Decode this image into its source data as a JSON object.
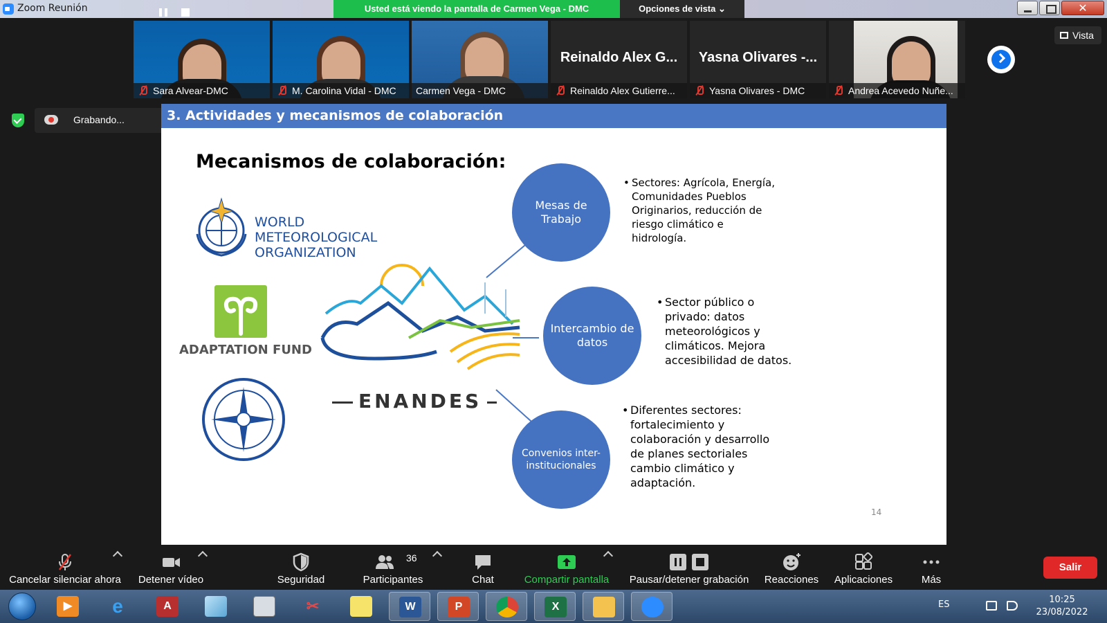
{
  "window": {
    "title": "Zoom Reunión",
    "viewing_banner": "Usted está viendo la pantalla de Carmen Vega - DMC",
    "view_options": "Opciones de vista ⌄",
    "close_glyph": "✕"
  },
  "participants": [
    {
      "name": "Sara Alvear-DMC",
      "muted": true
    },
    {
      "name": "M. Carolina Vidal - DMC",
      "muted": true
    },
    {
      "name": "Carmen Vega - DMC",
      "muted": false,
      "active": true
    },
    {
      "name": "Reinaldo Alex Gutierre...",
      "display": "Reinaldo Alex G...",
      "muted": true
    },
    {
      "name": "Yasna Olivares - DMC",
      "display": "Yasna Olivares -...",
      "muted": true
    },
    {
      "name": "Andrea Acevedo Nuñe...",
      "muted": true
    }
  ],
  "view_button": "Vista",
  "recording": {
    "label": "Grabando..."
  },
  "slide": {
    "header": "3. Actividades y mecanismos de colaboración",
    "title": "Mecanismos de colaboración:",
    "logos": {
      "wmo_lines": [
        "WORLD",
        "METEOROLOGICAL",
        "ORGANIZATION"
      ],
      "adaptation_fund": "ADAPTATION FUND",
      "enandes": "ENANDES"
    },
    "circles": [
      {
        "label": "Mesas de Trabajo"
      },
      {
        "label": "Intercambio de datos"
      },
      {
        "label": "Convenios inter-institucionales"
      }
    ],
    "bullets": [
      "Sectores: Agrícola, Energía, Comunidades Pueblos Originarios, reducción de riesgo climático e hidrología.",
      "Sector público o privado: datos meteorológicos y climáticos. Mejora accesibilidad de datos.",
      "Diferentes sectores: fortalecimiento y colaboración y desarrollo de planes sectoriales cambio climático y adaptación."
    ],
    "page_number": "14"
  },
  "toolbar": {
    "unmute": "Cancelar silenciar ahora",
    "video": "Detener vídeo",
    "security": "Seguridad",
    "participants": "Participantes",
    "participants_count": "36",
    "chat": "Chat",
    "share": "Compartir pantalla",
    "record": "Pausar/detener grabación",
    "reactions": "Reacciones",
    "apps": "Aplicaciones",
    "more": "Más",
    "leave": "Salir"
  },
  "taskbar": {
    "apps": [
      "media-player",
      "internet-explorer",
      "access",
      "notepad",
      "calculator",
      "snipping-tool",
      "sticky-notes",
      "word",
      "powerpoint",
      "chrome",
      "excel",
      "explorer",
      "zoom"
    ],
    "word_letter": "W",
    "powerpoint_letter": "P",
    "excel_letter": "X",
    "access_letter": "A",
    "language": "ES",
    "time": "10:25",
    "date": "23/08/2022"
  },
  "colors": {
    "banner_green": "#1ebe4d",
    "slide_blue": "#4672c2",
    "leave_red": "#e02828",
    "zoom_blue": "#0e72ed"
  }
}
